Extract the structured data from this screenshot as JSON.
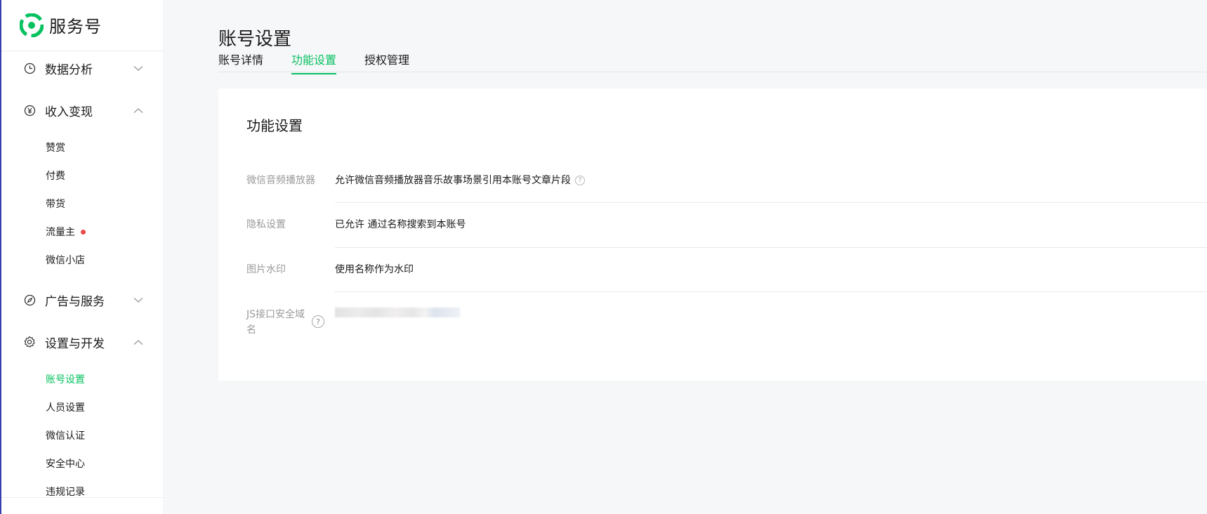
{
  "brand": {
    "name": "服务号",
    "logo_color": "#07c160"
  },
  "accent_color": "#07c160",
  "sidebar": {
    "groups": [
      {
        "label": "数据分析",
        "icon": "clock-icon",
        "expanded": false
      },
      {
        "label": "收入变现",
        "icon": "yen-icon",
        "expanded": true,
        "items": [
          "赞赏",
          "付费",
          "带货",
          "流量主",
          "微信小店"
        ]
      },
      {
        "label": "广告与服务",
        "icon": "compass-icon",
        "expanded": false
      },
      {
        "label": "设置与开发",
        "icon": "gear-icon",
        "expanded": true,
        "items": [
          "账号设置",
          "人员设置",
          "微信认证",
          "安全中心",
          "违规记录"
        ]
      }
    ],
    "active_item": "账号设置"
  },
  "page": {
    "title": "账号设置",
    "tabs": [
      "账号详情",
      "功能设置",
      "授权管理"
    ],
    "active_tab": "功能设置"
  },
  "panel": {
    "title": "功能设置",
    "rows": [
      {
        "label": "微信音频播放器",
        "value": "允许微信音频播放器音乐故事场景引用本账号文章片段"
      },
      {
        "label": "隐私设置",
        "value": "已允许 通过名称搜索到本账号"
      },
      {
        "label": "图片水印",
        "value": "使用名称作为水印"
      },
      {
        "label": "JS接口安全域名",
        "value": ""
      }
    ],
    "help_symbol": "?"
  }
}
